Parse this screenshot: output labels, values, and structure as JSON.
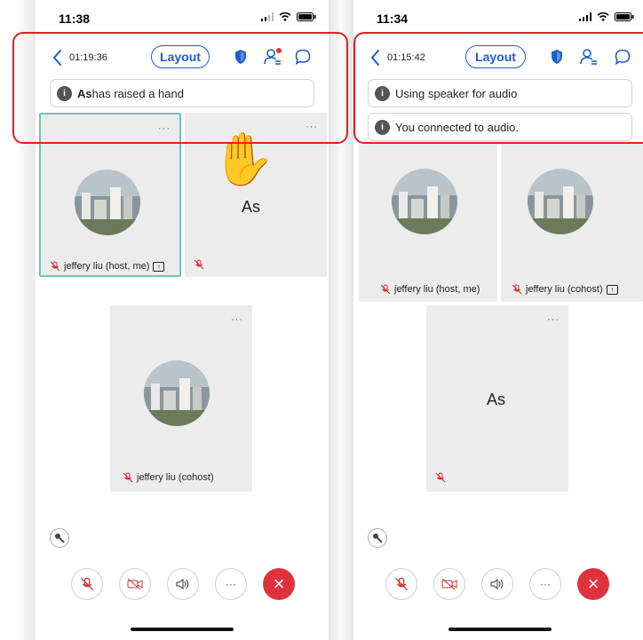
{
  "left": {
    "status_time": "11:38",
    "timer": "01:19:36",
    "layout_label": "Layout",
    "notice_strong": "As",
    "notice_rest": " has raised a hand",
    "tiles": {
      "host_name": "jeffery liu (host, me)",
      "as_name": "As",
      "cohost_name": "jeffery liu (cohost)",
      "menu": "···"
    }
  },
  "right": {
    "status_time": "11:34",
    "timer": "01:15:42",
    "layout_label": "Layout",
    "notice1": "Using speaker for audio",
    "notice2": "You connected to audio.",
    "tiles": {
      "host_name": "jeffery liu (host, me)",
      "cohost_name": "jeffery liu (cohost)",
      "as_name": "As",
      "menu": "···"
    }
  },
  "controls": {
    "more_label": "···",
    "end_label": "×"
  },
  "colors": {
    "accent": "#1f5fc9",
    "active_tile": "#6cc5b5",
    "end_call": "#e0323e",
    "highlight": "#e02020"
  }
}
